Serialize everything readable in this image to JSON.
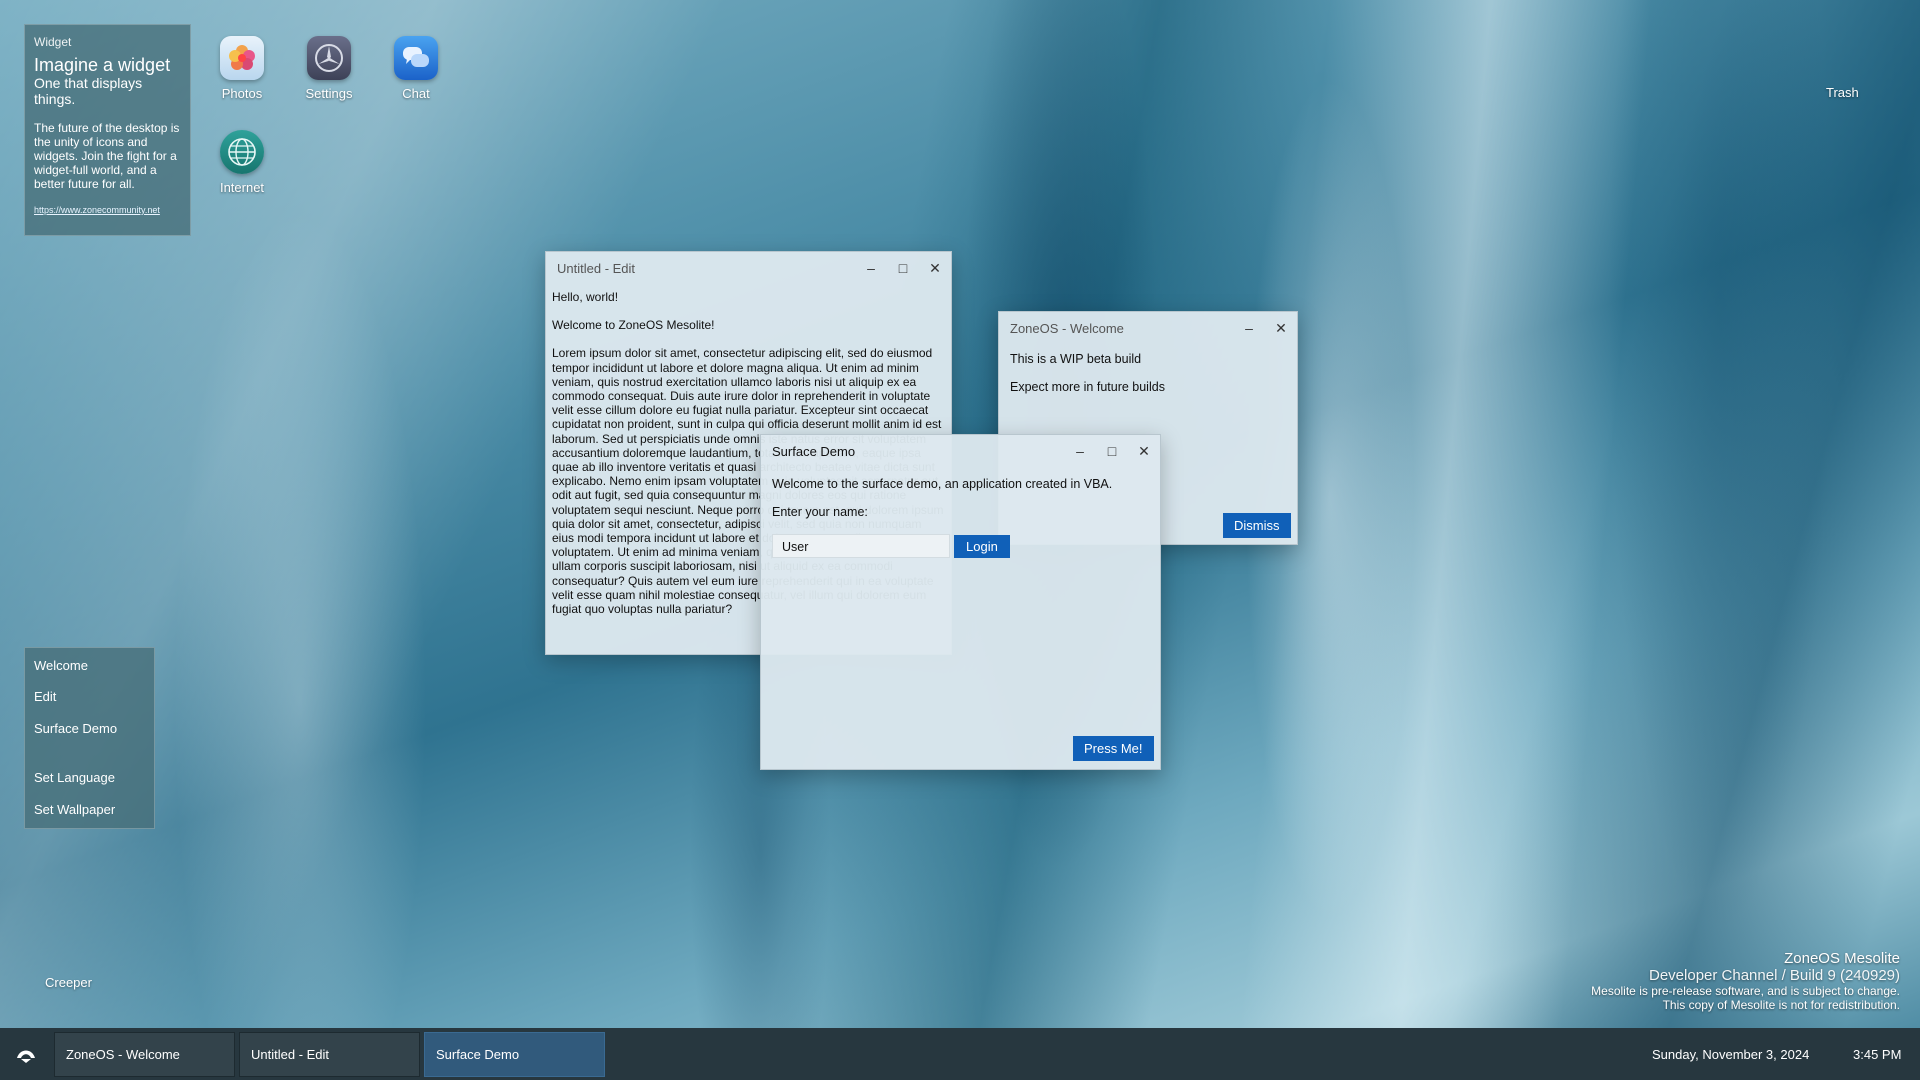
{
  "widget": {
    "header": "Widget",
    "title": "Imagine a widget",
    "subtitle": "One that displays things.",
    "body": "The future of the desktop is the unity of icons and widgets. Join the fight for a widget-full world, and a better future for all.",
    "link": "https://www.zonecommunity.net"
  },
  "desktop_icons": [
    {
      "label": "Photos",
      "icon": "photos-icon"
    },
    {
      "label": "Settings",
      "icon": "settings-icon"
    },
    {
      "label": "Chat",
      "icon": "chat-icon"
    },
    {
      "label": "Internet",
      "icon": "globe-icon"
    }
  ],
  "trash": {
    "label": "Trash"
  },
  "edit_window": {
    "title": "Untitled - Edit",
    "line1": "Hello, world!",
    "line2": "Welcome to ZoneOS Mesolite!",
    "body": "Lorem ipsum dolor sit amet, consectetur adipiscing elit, sed do eiusmod tempor incididunt ut labore et dolore magna aliqua. Ut enim ad minim veniam, quis nostrud exercitation ullamco laboris nisi ut aliquip ex ea commodo consequat. Duis aute irure dolor in reprehenderit in voluptate velit esse cillum dolore eu fugiat nulla pariatur. Excepteur sint occaecat cupidatat non proident, sunt in culpa qui officia deserunt mollit anim id est laborum. Sed ut perspiciatis unde omnis iste natus error sit voluptatem accusantium doloremque laudantium, totam rem aperiam, eaque ipsa quae ab illo inventore veritatis et quasi architecto beatae vitae dicta sunt explicabo. Nemo enim ipsam voluptatem quia voluptas sit aspernatur aut odit aut fugit, sed quia consequuntur magni dolores eos qui ratione voluptatem sequi nesciunt. Neque porro quisquam est, qui dolorem ipsum quia dolor sit amet, consectetur, adipisci velit, sed quia non numquam eius modi tempora incidunt ut labore et dolore magnam aliquam quaerat voluptatem. Ut enim ad minima veniam, quis nostrum exercitationem ullam corporis suscipit laboriosam, nisi ut aliquid ex ea commodi consequatur? Quis autem vel eum iure reprehenderit qui in ea voluptate velit esse quam nihil molestiae consequatur, vel illum qui dolorem eum fugiat quo voluptas nulla pariatur?"
  },
  "welcome_window": {
    "title": "ZoneOS - Welcome",
    "line1": "This is a WIP beta build",
    "line2": "Expect more in future builds",
    "dismiss": "Dismiss"
  },
  "surface_window": {
    "title": "Surface Demo",
    "intro": "Welcome to the surface demo, an application created in VBA.",
    "prompt": "Enter your name:",
    "name_value": "User",
    "login": "Login",
    "press": "Press Me!"
  },
  "side_menu": {
    "items": [
      "Welcome",
      "Edit",
      "Surface Demo",
      "Set Language",
      "Set Wallpaper"
    ]
  },
  "creeper": "Creeper",
  "watermark": {
    "product": "ZoneOS Mesolite",
    "channel": "Developer Channel / Build 9 (240929)",
    "note1": "Mesolite is pre-release software, and is subject to change.",
    "note2": "This copy of Mesolite is not for redistribution."
  },
  "taskbar": {
    "items": [
      {
        "label": "ZoneOS - Welcome",
        "active": false
      },
      {
        "label": "Untitled - Edit",
        "active": false
      },
      {
        "label": "Surface Demo",
        "active": true
      }
    ],
    "date": "Sunday, November 3, 2024",
    "time": "3:45 PM"
  },
  "colors": {
    "accent": "#1060b8",
    "taskbar": "#27373f",
    "window": "#dde8ee"
  }
}
